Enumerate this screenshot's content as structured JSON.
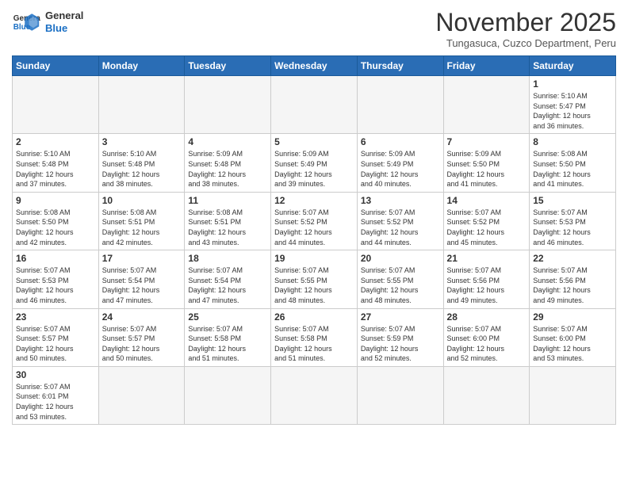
{
  "header": {
    "logo_general": "General",
    "logo_blue": "Blue",
    "month_title": "November 2025",
    "subtitle": "Tungasuca, Cuzco Department, Peru"
  },
  "weekdays": [
    "Sunday",
    "Monday",
    "Tuesday",
    "Wednesday",
    "Thursday",
    "Friday",
    "Saturday"
  ],
  "weeks": [
    [
      {
        "day": "",
        "info": ""
      },
      {
        "day": "",
        "info": ""
      },
      {
        "day": "",
        "info": ""
      },
      {
        "day": "",
        "info": ""
      },
      {
        "day": "",
        "info": ""
      },
      {
        "day": "",
        "info": ""
      },
      {
        "day": "1",
        "info": "Sunrise: 5:10 AM\nSunset: 5:47 PM\nDaylight: 12 hours\nand 36 minutes."
      }
    ],
    [
      {
        "day": "2",
        "info": "Sunrise: 5:10 AM\nSunset: 5:48 PM\nDaylight: 12 hours\nand 37 minutes."
      },
      {
        "day": "3",
        "info": "Sunrise: 5:10 AM\nSunset: 5:48 PM\nDaylight: 12 hours\nand 38 minutes."
      },
      {
        "day": "4",
        "info": "Sunrise: 5:09 AM\nSunset: 5:48 PM\nDaylight: 12 hours\nand 38 minutes."
      },
      {
        "day": "5",
        "info": "Sunrise: 5:09 AM\nSunset: 5:49 PM\nDaylight: 12 hours\nand 39 minutes."
      },
      {
        "day": "6",
        "info": "Sunrise: 5:09 AM\nSunset: 5:49 PM\nDaylight: 12 hours\nand 40 minutes."
      },
      {
        "day": "7",
        "info": "Sunrise: 5:09 AM\nSunset: 5:50 PM\nDaylight: 12 hours\nand 41 minutes."
      },
      {
        "day": "8",
        "info": "Sunrise: 5:08 AM\nSunset: 5:50 PM\nDaylight: 12 hours\nand 41 minutes."
      }
    ],
    [
      {
        "day": "9",
        "info": "Sunrise: 5:08 AM\nSunset: 5:50 PM\nDaylight: 12 hours\nand 42 minutes."
      },
      {
        "day": "10",
        "info": "Sunrise: 5:08 AM\nSunset: 5:51 PM\nDaylight: 12 hours\nand 42 minutes."
      },
      {
        "day": "11",
        "info": "Sunrise: 5:08 AM\nSunset: 5:51 PM\nDaylight: 12 hours\nand 43 minutes."
      },
      {
        "day": "12",
        "info": "Sunrise: 5:07 AM\nSunset: 5:52 PM\nDaylight: 12 hours\nand 44 minutes."
      },
      {
        "day": "13",
        "info": "Sunrise: 5:07 AM\nSunset: 5:52 PM\nDaylight: 12 hours\nand 44 minutes."
      },
      {
        "day": "14",
        "info": "Sunrise: 5:07 AM\nSunset: 5:52 PM\nDaylight: 12 hours\nand 45 minutes."
      },
      {
        "day": "15",
        "info": "Sunrise: 5:07 AM\nSunset: 5:53 PM\nDaylight: 12 hours\nand 46 minutes."
      }
    ],
    [
      {
        "day": "16",
        "info": "Sunrise: 5:07 AM\nSunset: 5:53 PM\nDaylight: 12 hours\nand 46 minutes."
      },
      {
        "day": "17",
        "info": "Sunrise: 5:07 AM\nSunset: 5:54 PM\nDaylight: 12 hours\nand 47 minutes."
      },
      {
        "day": "18",
        "info": "Sunrise: 5:07 AM\nSunset: 5:54 PM\nDaylight: 12 hours\nand 47 minutes."
      },
      {
        "day": "19",
        "info": "Sunrise: 5:07 AM\nSunset: 5:55 PM\nDaylight: 12 hours\nand 48 minutes."
      },
      {
        "day": "20",
        "info": "Sunrise: 5:07 AM\nSunset: 5:55 PM\nDaylight: 12 hours\nand 48 minutes."
      },
      {
        "day": "21",
        "info": "Sunrise: 5:07 AM\nSunset: 5:56 PM\nDaylight: 12 hours\nand 49 minutes."
      },
      {
        "day": "22",
        "info": "Sunrise: 5:07 AM\nSunset: 5:56 PM\nDaylight: 12 hours\nand 49 minutes."
      }
    ],
    [
      {
        "day": "23",
        "info": "Sunrise: 5:07 AM\nSunset: 5:57 PM\nDaylight: 12 hours\nand 50 minutes."
      },
      {
        "day": "24",
        "info": "Sunrise: 5:07 AM\nSunset: 5:57 PM\nDaylight: 12 hours\nand 50 minutes."
      },
      {
        "day": "25",
        "info": "Sunrise: 5:07 AM\nSunset: 5:58 PM\nDaylight: 12 hours\nand 51 minutes."
      },
      {
        "day": "26",
        "info": "Sunrise: 5:07 AM\nSunset: 5:58 PM\nDaylight: 12 hours\nand 51 minutes."
      },
      {
        "day": "27",
        "info": "Sunrise: 5:07 AM\nSunset: 5:59 PM\nDaylight: 12 hours\nand 52 minutes."
      },
      {
        "day": "28",
        "info": "Sunrise: 5:07 AM\nSunset: 6:00 PM\nDaylight: 12 hours\nand 52 minutes."
      },
      {
        "day": "29",
        "info": "Sunrise: 5:07 AM\nSunset: 6:00 PM\nDaylight: 12 hours\nand 53 minutes."
      }
    ],
    [
      {
        "day": "30",
        "info": "Sunrise: 5:07 AM\nSunset: 6:01 PM\nDaylight: 12 hours\nand 53 minutes."
      },
      {
        "day": "",
        "info": ""
      },
      {
        "day": "",
        "info": ""
      },
      {
        "day": "",
        "info": ""
      },
      {
        "day": "",
        "info": ""
      },
      {
        "day": "",
        "info": ""
      },
      {
        "day": "",
        "info": ""
      }
    ]
  ]
}
